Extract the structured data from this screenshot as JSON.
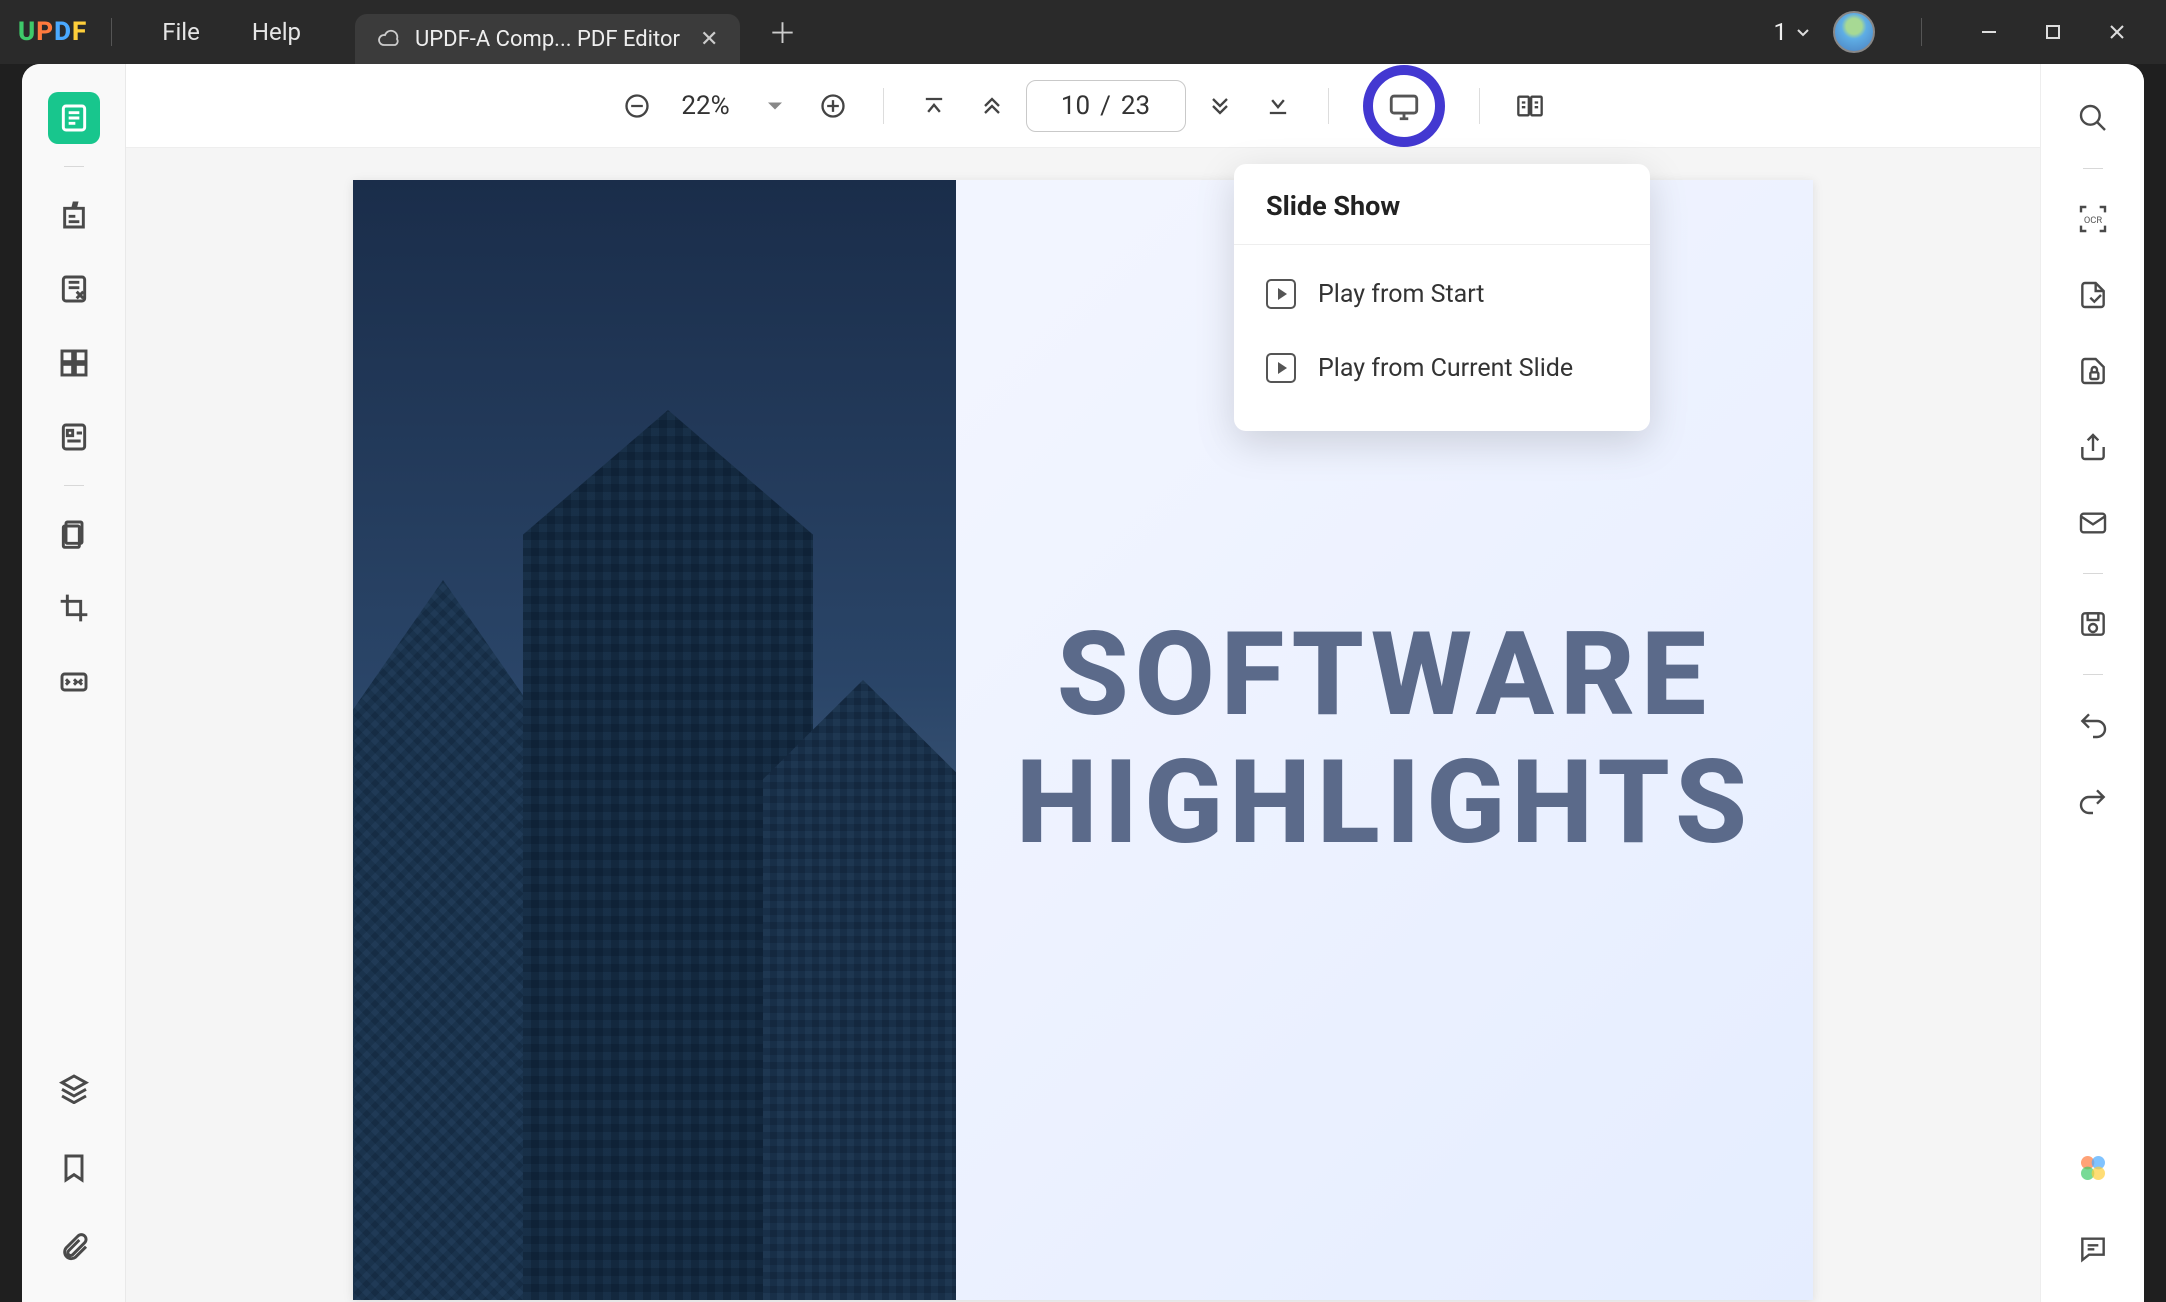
{
  "app": {
    "logo": "UPDF",
    "menu": {
      "file": "File",
      "help": "Help"
    },
    "tab": {
      "title": "UPDF-A Comp... PDF Editor"
    },
    "window_count": "1"
  },
  "toolbar": {
    "zoom": "22%",
    "page_current": "10",
    "page_sep": "/",
    "page_total": "23"
  },
  "dropdown": {
    "title": "Slide Show",
    "item1": "Play from Start",
    "item2": "Play from Current Slide"
  },
  "slide": {
    "line1": "SOFTWARE",
    "line2": "HIGHLIGHTS"
  }
}
